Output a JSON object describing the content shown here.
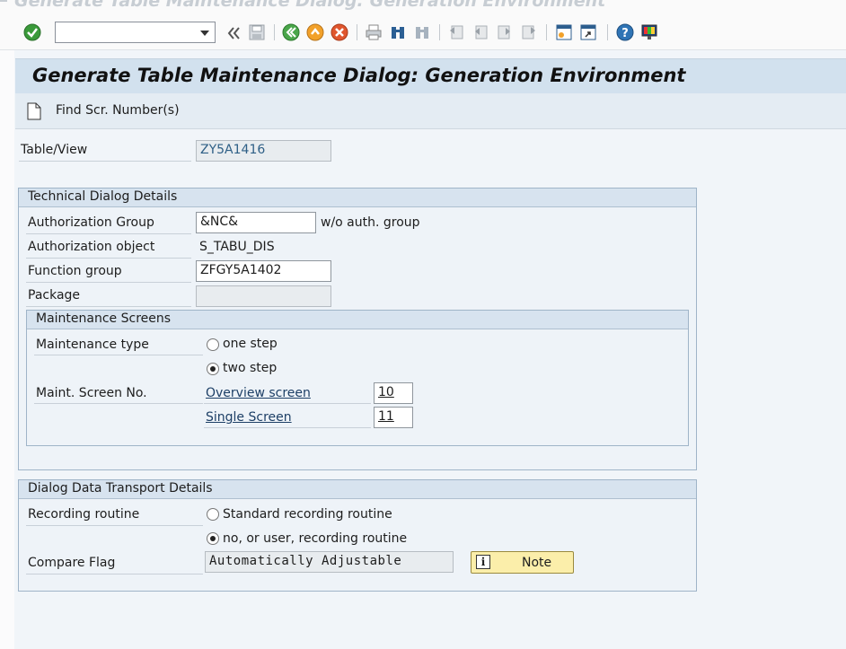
{
  "window": {
    "title": "Generate Table Maintenance Dialog: Generation Environment"
  },
  "toolbar": {
    "command_field_value": "",
    "icons": [
      "enter-icon",
      "back-double-arrow-icon",
      "save-icon",
      "back-icon",
      "exit-icon",
      "cancel-icon",
      "print-icon",
      "find-icon",
      "find-next-icon",
      "first-page-icon",
      "previous-page-icon",
      "next-page-icon",
      "last-page-icon",
      "new-session-icon",
      "create-shortcut-icon",
      "help-icon",
      "customize-layout-icon"
    ]
  },
  "page": {
    "title": "Generate Table Maintenance Dialog: Generation Environment"
  },
  "app_toolbar": {
    "find_label": "Find Scr. Number(s)"
  },
  "table_view": {
    "label": "Table/View",
    "value": "ZY5A1416"
  },
  "technical": {
    "title": "Technical Dialog Details",
    "auth_group_label": "Authorization Group",
    "auth_group_value": "&NC&",
    "auth_group_hint": "w/o auth. group",
    "auth_object_label": "Authorization object",
    "auth_object_value": "S_TABU_DIS",
    "function_group_label": "Function group",
    "function_group_value": "ZFGY5A1402",
    "package_label": "Package",
    "package_value": "",
    "screens": {
      "title": "Maintenance Screens",
      "maint_type_label": "Maintenance type",
      "option_one": "one step",
      "option_two": "two step",
      "selected": "two step",
      "screen_no_label": "Maint. Screen No.",
      "overview_label": "Overview screen",
      "overview_value": "10",
      "single_label": "Single Screen",
      "single_value": "11"
    }
  },
  "transport": {
    "title": "Dialog Data Transport Details",
    "recording_label": "Recording routine",
    "option_standard": "Standard recording routine",
    "option_user": "no, or user, recording routine",
    "selected": "no, or user, recording routine",
    "compare_label": "Compare Flag",
    "compare_value": "Automatically Adjustable",
    "note_button": "Note"
  }
}
